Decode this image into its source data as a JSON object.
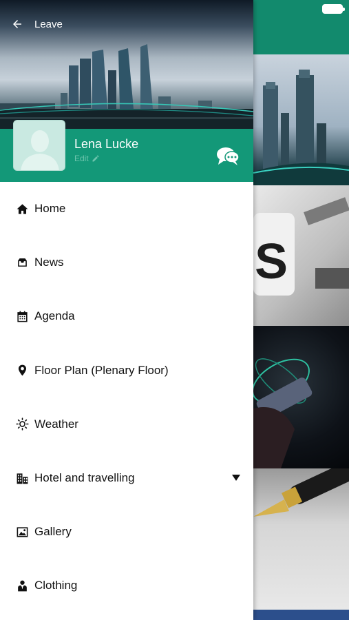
{
  "header": {
    "back_label": "Leave"
  },
  "profile": {
    "name": "Lena Lucke",
    "edit_label": "Edit"
  },
  "menu": {
    "items": [
      {
        "label": "Home",
        "icon": "home-icon"
      },
      {
        "label": "News",
        "icon": "inbox-icon"
      },
      {
        "label": "Agenda",
        "icon": "calendar-icon"
      },
      {
        "label": "Floor Plan (Plenary Floor)",
        "icon": "map-pin-icon"
      },
      {
        "label": "Weather",
        "icon": "sun-icon"
      },
      {
        "label": "Hotel and travelling",
        "icon": "building-icon",
        "expandable": true
      },
      {
        "label": "Gallery",
        "icon": "image-icon"
      },
      {
        "label": "Clothing",
        "icon": "person-suit-icon"
      }
    ]
  },
  "colors": {
    "accent": "#139878",
    "background_topbar": "#128a6d",
    "edit_text": "#6dc4ad"
  }
}
